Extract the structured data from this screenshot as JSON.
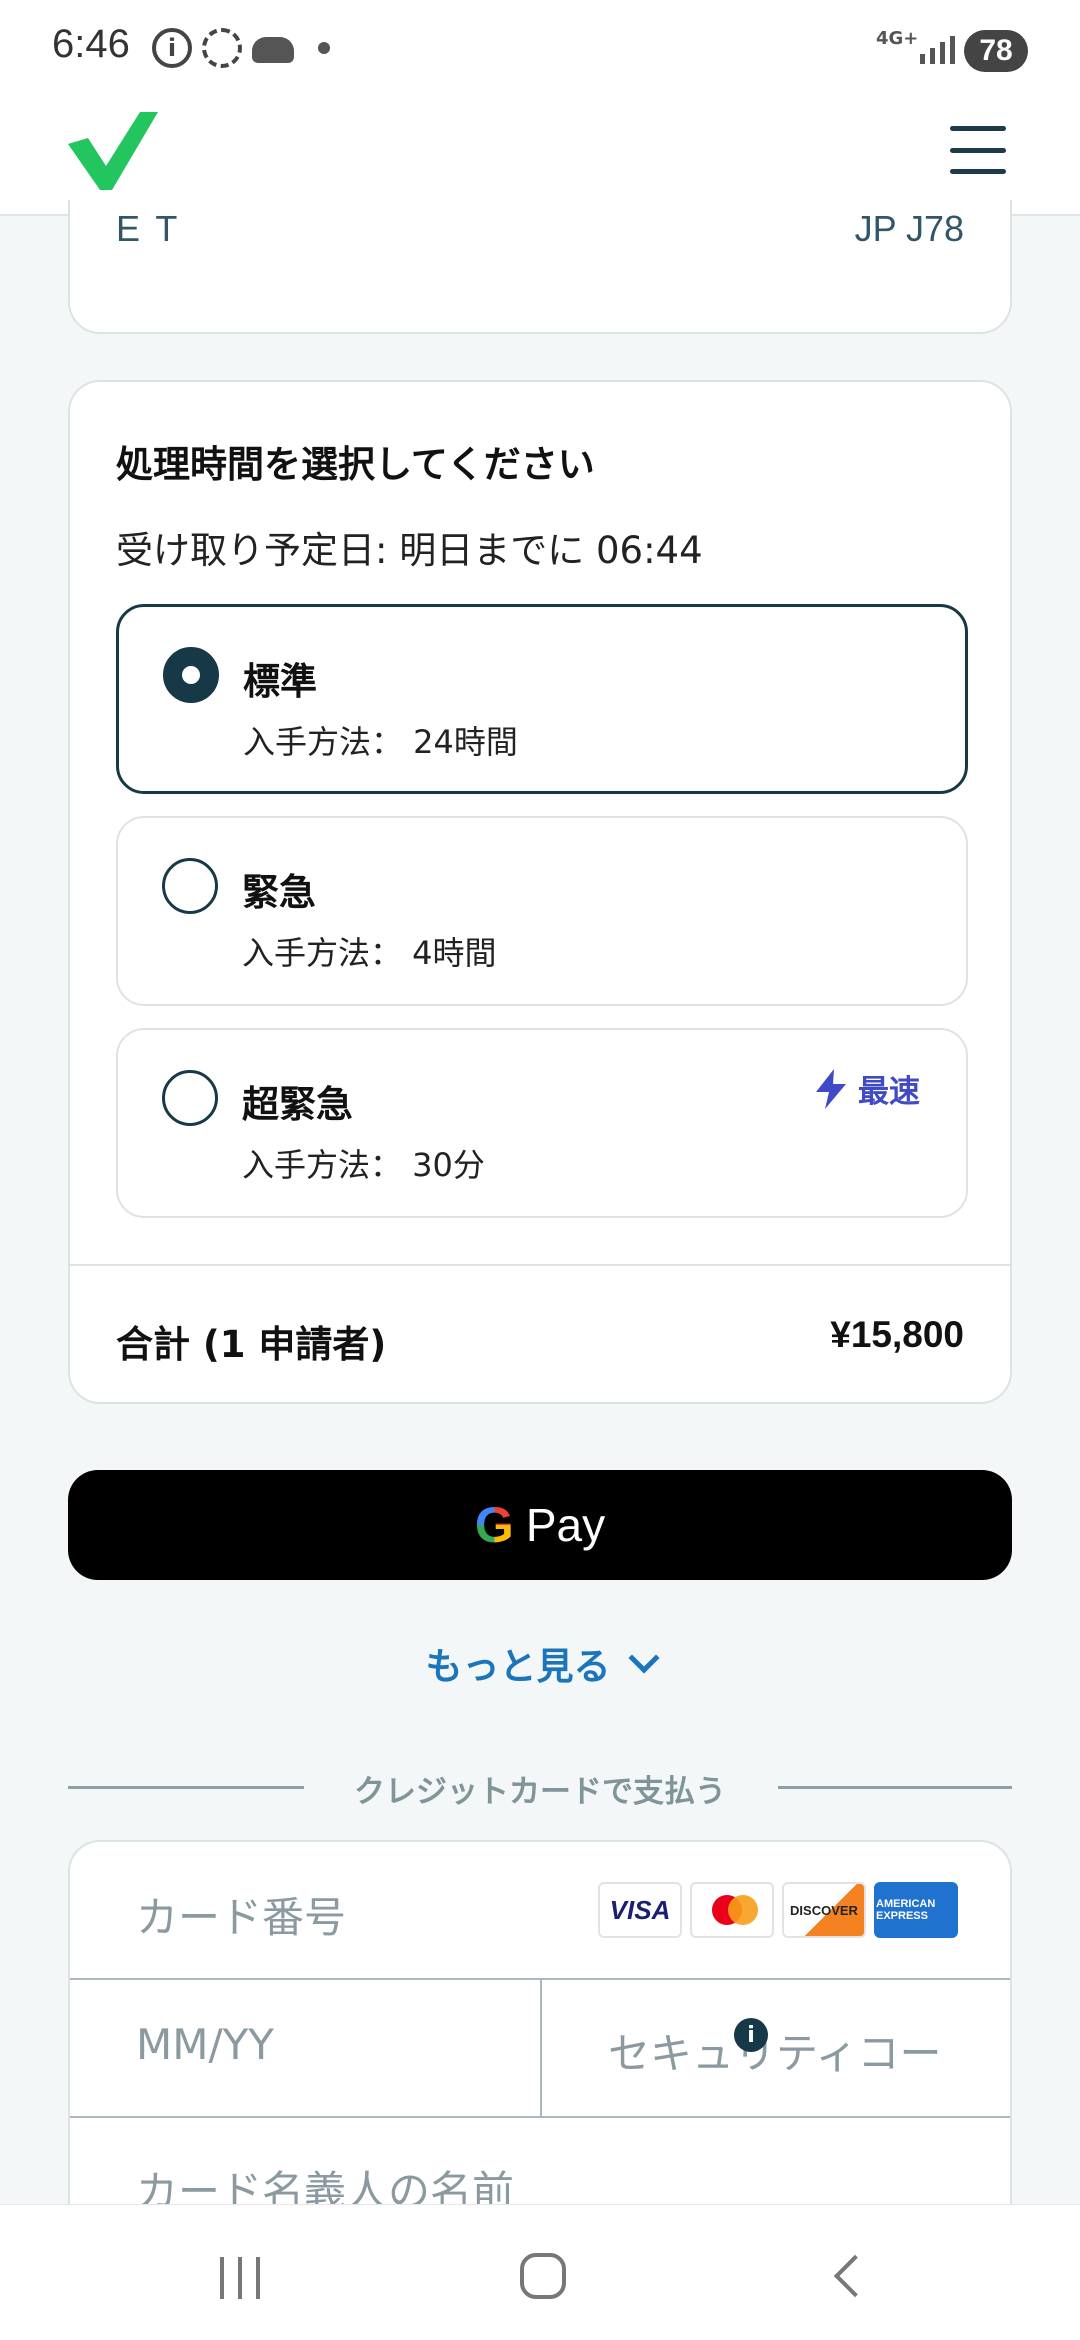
{
  "status_bar": {
    "time": "6:46",
    "info_icon_glyph": "i",
    "network": "4G+",
    "battery": "78"
  },
  "header": {
    "logo_color": "#22c55e",
    "menu_icon": "hamburger-menu-icon"
  },
  "passport_card": {
    "left_text": "E T",
    "right_text": "JP J78"
  },
  "processing": {
    "title": "処理時間を選択してください",
    "pickup": "受け取り予定日: 明日までに 06:44",
    "options": [
      {
        "name": "標準",
        "time": "入手方法： 24時間",
        "selected": true
      },
      {
        "name": "緊急",
        "time": "入手方法： 4時間",
        "selected": false
      },
      {
        "name": "超緊急",
        "time": "入手方法： 30分",
        "selected": false,
        "badge": "最速"
      }
    ],
    "total_label": "合計 (1 申請者)",
    "total_value": "¥15,800"
  },
  "gpay": {
    "g": "G",
    "label": "Pay"
  },
  "more": {
    "label": "もっと見る"
  },
  "divider": {
    "text": "クレジットカードで支払う"
  },
  "card_form": {
    "card_number_placeholder": "カード番号",
    "expiry_placeholder": "MM/YY",
    "cvc_placeholder": "セキュリティコー",
    "name_placeholder": "カード名義人の名前",
    "logos": {
      "visa": "VISA",
      "discover": "DISCOVER",
      "amex": "AMERICAN EXPRESS"
    },
    "info_glyph": "i"
  },
  "colors": {
    "accent_dark": "#173947",
    "link_blue": "#1c74bb",
    "badge_blue": "#4049c6"
  }
}
